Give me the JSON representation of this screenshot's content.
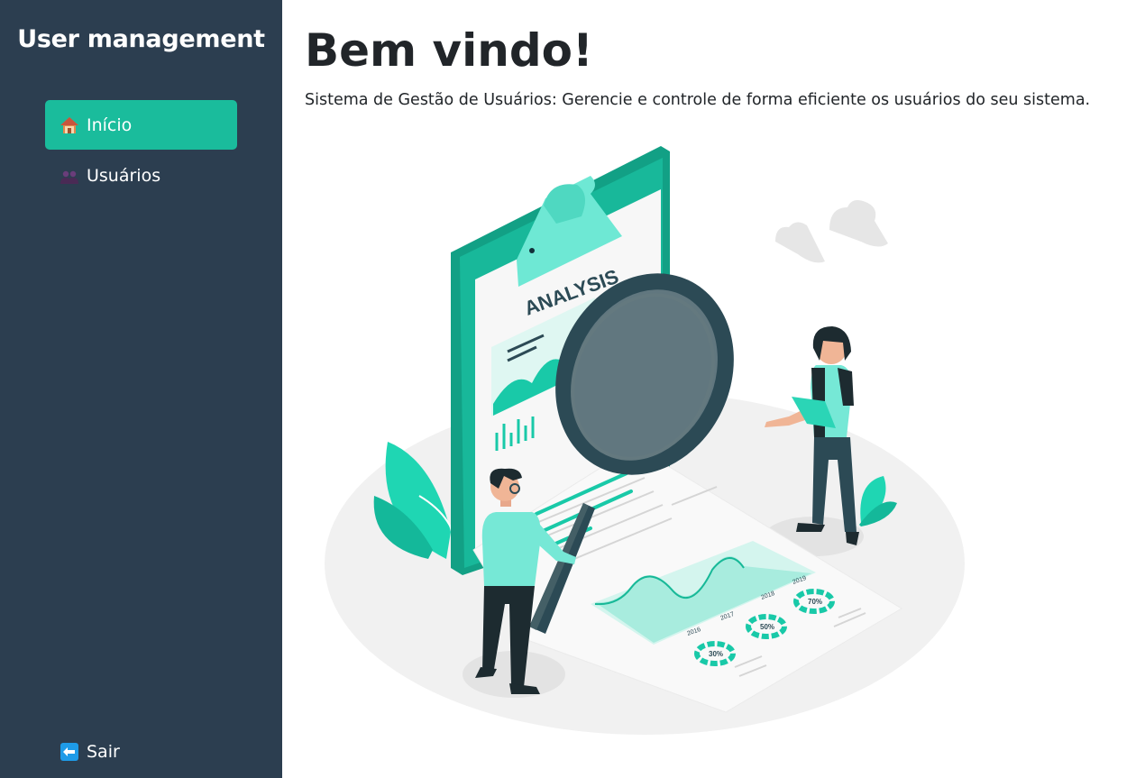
{
  "sidebar": {
    "brand": "User management",
    "items": [
      {
        "label": "Início",
        "icon": "house-icon",
        "active": true
      },
      {
        "label": "Usuários",
        "icon": "users-icon",
        "active": false
      }
    ],
    "logout": {
      "label": "Sair",
      "icon": "arrow-left-icon"
    }
  },
  "main": {
    "title": "Bem vindo!",
    "subtitle": "Sistema de Gestão de Usuários: Gerencie e controle de forma eficiente os usuários do seu sistema."
  },
  "illustration": {
    "heading": "ANALYSIS",
    "years": [
      "2016",
      "2017",
      "2018",
      "2019"
    ],
    "percentages": [
      "30%",
      "50%",
      "70%"
    ]
  },
  "colors": {
    "sidebar": "#2c3e50",
    "active_item": "#1abc9c",
    "accent": "#00bfa5",
    "dark_teal": "#12a085"
  }
}
